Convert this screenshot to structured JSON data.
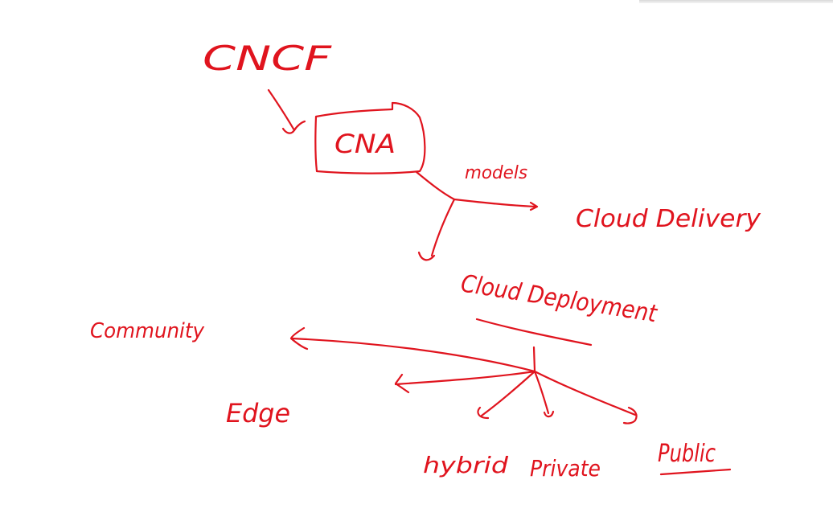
{
  "ink_color": "#e0141e",
  "labels": {
    "cncf": "CNCF",
    "cna": "CNA",
    "models": "models",
    "cloud_delivery": "Cloud Delivery",
    "cloud_deployment": "Cloud Deployment",
    "community": "Community",
    "edge": "Edge",
    "hybrid": "hybrid",
    "private": "Private",
    "public": "Public"
  }
}
